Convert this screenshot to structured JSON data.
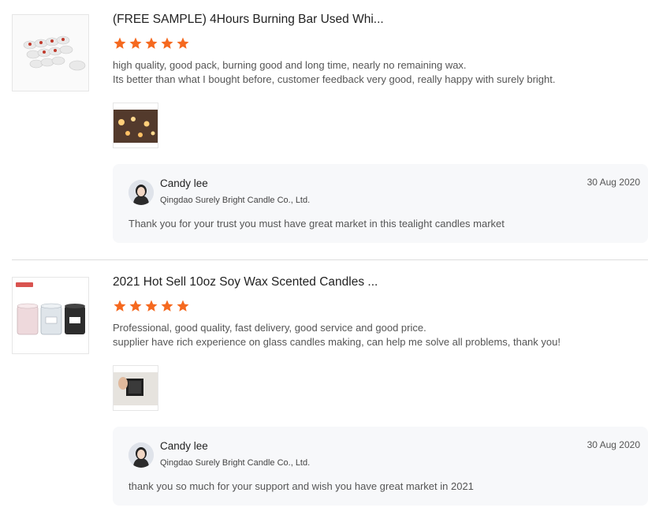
{
  "reviews": [
    {
      "product_title": "(FREE SAMPLE) 4Hours Burning Bar Used Whi...",
      "rating": 5,
      "review_text": [
        "high quality, good pack, burning good and long time, nearly no remaining wax.",
        "Its better than what I bought before, customer feedback very good, really happy with surely bright."
      ],
      "reply": {
        "name": "Candy lee",
        "company": "Qingdao Surely Bright Candle Co., Ltd.",
        "date": "30 Aug 2020",
        "text": "Thank you for your trust you must have  great market in this tealight candles market"
      }
    },
    {
      "product_title": "2021 Hot Sell 10oz Soy Wax Scented Candles ...",
      "rating": 5,
      "review_text": [
        "Professional, good quality, fast delivery, good service and good price.",
        "supplier have rich experience on glass candles making, can help me solve all problems, thank you!"
      ],
      "reply": {
        "name": "Candy lee",
        "company": "Qingdao Surely Bright Candle Co., Ltd.",
        "date": "30 Aug 2020",
        "text": "thank you so much for your support and wish you have great market in 2021"
      }
    }
  ],
  "colors": {
    "star": "#f5691f",
    "reply_bg": "#f7f8fa",
    "divider": "#dddddd"
  },
  "icons": {
    "star": "star-icon"
  }
}
